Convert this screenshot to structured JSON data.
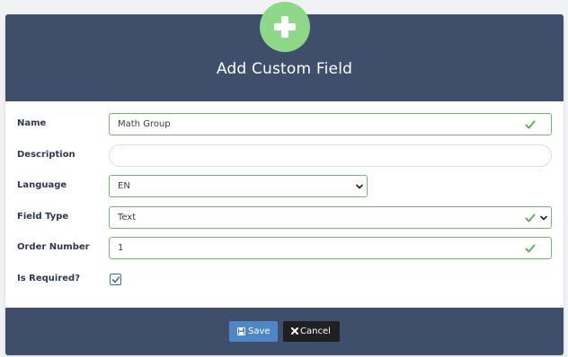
{
  "header": {
    "title": "Add Custom Field",
    "badge_icon": "plus-icon",
    "color": "#3f4e6b",
    "badge_color": "#8fd88a"
  },
  "form": {
    "name": {
      "label": "Name",
      "value": "Math Group",
      "valid": true
    },
    "description": {
      "label": "Description",
      "value": ""
    },
    "language": {
      "label": "Language",
      "value": "EN"
    },
    "field_type": {
      "label": "Field Type",
      "value": "Text",
      "valid": true
    },
    "order_number": {
      "label": "Order Number",
      "value": "1",
      "valid": true
    },
    "is_required": {
      "label": "Is Required?",
      "checked": true
    }
  },
  "footer": {
    "save_label": "Save",
    "cancel_label": "Cancel",
    "save_icon": "floppy-disk-icon",
    "cancel_icon": "close-icon",
    "save_color": "#4f86c6",
    "cancel_color": "#1f2022"
  },
  "colors": {
    "valid": "#6cb96a"
  }
}
